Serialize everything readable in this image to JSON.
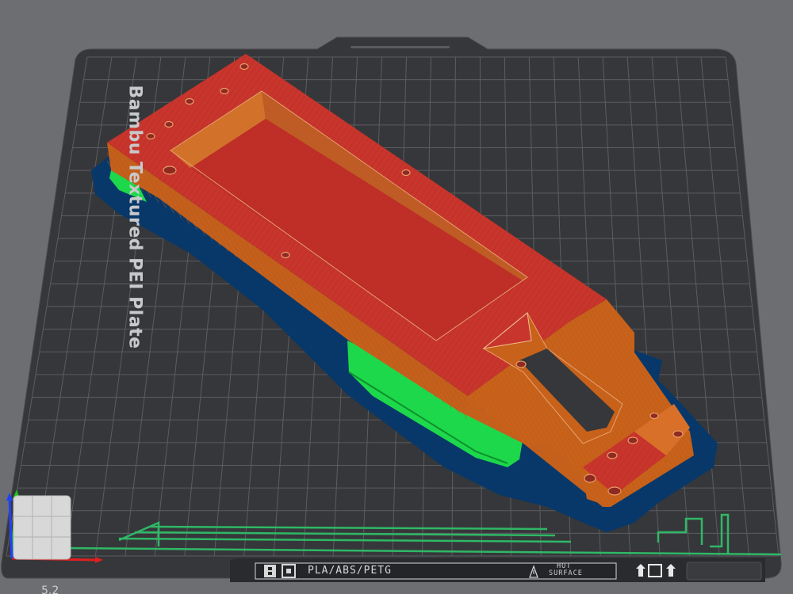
{
  "plate": {
    "label": "Bambu Textured PEI Plate",
    "filament_types": "PLA/ABS/PETG",
    "hot_surface_line1": "HOT",
    "hot_surface_line2": "SURFACE"
  },
  "viewport": {
    "corner_indicator": "5.2"
  },
  "colors": {
    "background": "#6d6e72",
    "plate": "#36373a",
    "grid": "#5b5c60",
    "part_top": "#c8352c",
    "part_side": "#c8621a",
    "support": "#1dd84a",
    "brim": "#073869",
    "prime_tower": "#2fb866",
    "axis_x": "#e02020",
    "axis_y": "#20c020",
    "axis_z": "#2040ff"
  },
  "icons": [
    "bambu-logo-icon",
    "hot-surface-warning-icon",
    "plate-symbols-icon",
    "view-cube-icon"
  ]
}
